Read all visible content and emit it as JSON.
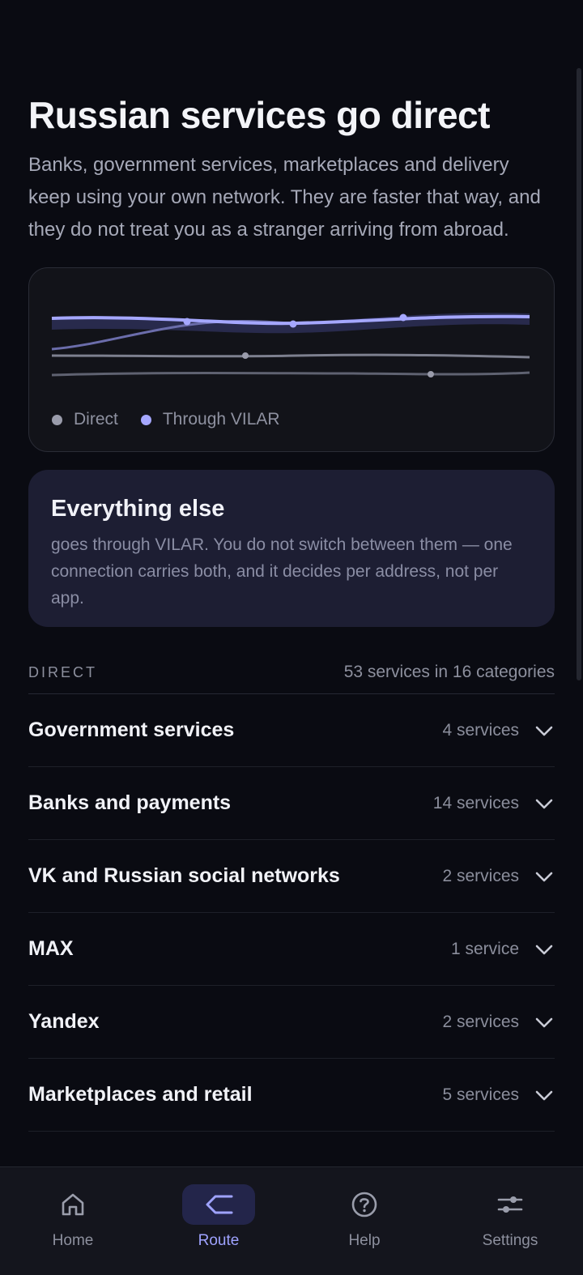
{
  "page": {
    "title": "Russian services go direct",
    "intro": "Banks, government services, marketplaces and delivery keep using your own network. They are faster that way, and they do not treat you as a stranger arriving from abroad."
  },
  "chart": {
    "legend": [
      {
        "label": "Direct",
        "color": "#9a9cab"
      },
      {
        "label": "Through VILAR",
        "color": "#a5a7ff"
      }
    ]
  },
  "info": {
    "title": "Everything else",
    "text": "goes through VILAR. You do not switch between them — one connection carries both, and it decides per address, not per app."
  },
  "section": {
    "label": "DIRECT",
    "count": "53 services in 16 categories"
  },
  "categories": [
    {
      "name": "Government services",
      "count": "4 services"
    },
    {
      "name": "Banks and payments",
      "count": "14 services"
    },
    {
      "name": "VK and Russian social networks",
      "count": "2 services"
    },
    {
      "name": "MAX",
      "count": "1 service"
    },
    {
      "name": "Yandex",
      "count": "2 services"
    },
    {
      "name": "Marketplaces and retail",
      "count": "5 services"
    }
  ],
  "nav": [
    {
      "label": "Home",
      "icon": "home-icon",
      "active": false
    },
    {
      "label": "Route",
      "icon": "route-icon",
      "active": true
    },
    {
      "label": "Help",
      "icon": "help-icon",
      "active": false
    },
    {
      "label": "Settings",
      "icon": "sliders-icon",
      "active": false
    }
  ],
  "colors": {
    "background": "#0a0b12",
    "accent": "#9fa3ff",
    "card": "#1d1e33"
  }
}
